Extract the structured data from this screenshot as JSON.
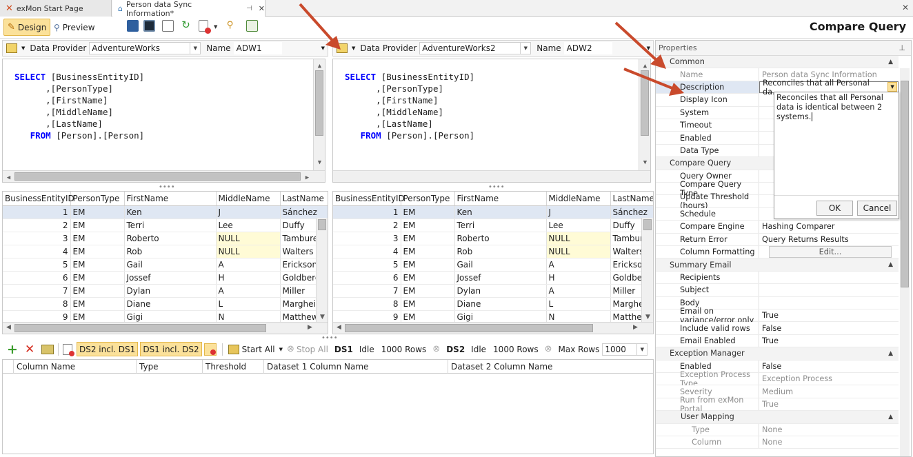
{
  "tabs": [
    {
      "label": "exMon Start Page",
      "active": false
    },
    {
      "label": "Person data Sync Information*",
      "active": true
    }
  ],
  "toolbar": {
    "design_label": "Design",
    "preview_label": "Preview",
    "page_title": "Compare Query"
  },
  "ds1": {
    "provider_label": "Data Provider",
    "provider_value": "AdventureWorks",
    "name_label": "Name",
    "name_value": "ADW1",
    "sql": [
      "SELECT",
      "[BusinessEntityID]",
      ",[PersonType]",
      ",[FirstName]",
      ",[MiddleName]",
      ",[LastName]",
      "FROM",
      "[Person].[Person]"
    ]
  },
  "ds2": {
    "provider_label": "Data Provider",
    "provider_value": "AdventureWorks2",
    "name_label": "Name",
    "name_value": "ADW2",
    "sql": [
      "SELECT",
      "[BusinessEntityID]",
      ",[PersonType]",
      ",[FirstName]",
      ",[MiddleName]",
      ",[LastName]",
      "FROM",
      "[Person].[Person]"
    ]
  },
  "grid": {
    "columns": [
      "BusinessEntityID",
      "PersonType",
      "FirstName",
      "MiddleName",
      "LastName"
    ],
    "rows1": [
      [
        "1",
        "EM",
        "Ken",
        "J",
        "Sánchez"
      ],
      [
        "2",
        "EM",
        "Terri",
        "Lee",
        "Duffy"
      ],
      [
        "3",
        "EM",
        "Roberto",
        "NULL",
        "Tamburello"
      ],
      [
        "4",
        "EM",
        "Rob",
        "NULL",
        "Walters"
      ],
      [
        "5",
        "EM",
        "Gail",
        "A",
        "Erickson"
      ],
      [
        "6",
        "EM",
        "Jossef",
        "H",
        "Goldberg"
      ],
      [
        "7",
        "EM",
        "Dylan",
        "A",
        "Miller"
      ],
      [
        "8",
        "EM",
        "Diane",
        "L",
        "Margheim"
      ],
      [
        "9",
        "EM",
        "Gigi",
        "N",
        "Matthew"
      ]
    ],
    "rows2": [
      [
        "1",
        "EM",
        "Ken",
        "J",
        "Sánchez"
      ],
      [
        "2",
        "EM",
        "Terri",
        "Lee",
        "Duffy"
      ],
      [
        "3",
        "EM",
        "Roberto",
        "NULL",
        "Tambure"
      ],
      [
        "4",
        "EM",
        "Rob",
        "NULL",
        "Walters"
      ],
      [
        "5",
        "EM",
        "Gail",
        "A",
        "Erickson"
      ],
      [
        "6",
        "EM",
        "Jossef",
        "H",
        "Goldberg"
      ],
      [
        "7",
        "EM",
        "Dylan",
        "A",
        "Miller"
      ],
      [
        "8",
        "EM",
        "Diane",
        "L",
        "Margheim"
      ],
      [
        "9",
        "EM",
        "Gigi",
        "N",
        "Matthew"
      ]
    ]
  },
  "compare_toolbar": {
    "ds2_incl_ds1": "DS2 incl. DS1",
    "ds1_incl_ds2": "DS1 incl. DS2",
    "start_all": "Start All",
    "stop_all": "Stop All",
    "ds1_label": "DS1",
    "ds1_status": "Idle",
    "ds1_rows": "1000 Rows",
    "ds2_label": "DS2",
    "ds2_status": "Idle",
    "ds2_rows": "1000 Rows",
    "max_rows_label": "Max Rows",
    "max_rows_value": "1000"
  },
  "compare_grid": {
    "columns": [
      "Column Name",
      "Type",
      "Threshold",
      "Dataset 1 Column Name",
      "Dataset 2 Column Name"
    ]
  },
  "properties": {
    "title": "Properties",
    "rows": [
      {
        "kind": "cat",
        "label": "Common"
      },
      {
        "kind": "prop",
        "label": "Name",
        "value": "Person data Sync Information",
        "dim": true
      },
      {
        "kind": "prop",
        "label": "Description",
        "value": "Reconciles that all Personal da...",
        "selected": true
      },
      {
        "kind": "prop",
        "label": "Display Icon",
        "value": ""
      },
      {
        "kind": "prop",
        "label": "System",
        "value": ""
      },
      {
        "kind": "prop",
        "label": "Timeout",
        "value": ""
      },
      {
        "kind": "prop",
        "label": "Enabled",
        "value": ""
      },
      {
        "kind": "prop",
        "label": "Data Type",
        "value": ""
      },
      {
        "kind": "cat",
        "label": "Compare Query"
      },
      {
        "kind": "prop",
        "label": "Query Owner",
        "value": ""
      },
      {
        "kind": "prop",
        "label": "Compare Query Type",
        "value": ""
      },
      {
        "kind": "prop",
        "label": "Update Threshold (hours)",
        "value": ""
      },
      {
        "kind": "prop",
        "label": "Schedule",
        "value": ""
      },
      {
        "kind": "prop",
        "label": "Compare Engine",
        "value": "Hashing Comparer"
      },
      {
        "kind": "prop",
        "label": "Return Error",
        "value": "Query Returns Results"
      },
      {
        "kind": "prop",
        "label": "Column Formatting",
        "value": "Edit...",
        "button": true
      },
      {
        "kind": "cat",
        "label": "Summary Email"
      },
      {
        "kind": "prop",
        "label": "Recipients",
        "value": ""
      },
      {
        "kind": "prop",
        "label": "Subject",
        "value": ""
      },
      {
        "kind": "prop",
        "label": "Body",
        "value": ""
      },
      {
        "kind": "prop",
        "label": "Email on variance/error only",
        "value": "True"
      },
      {
        "kind": "prop",
        "label": "Include valid rows",
        "value": "False"
      },
      {
        "kind": "prop",
        "label": "Email Enabled",
        "value": "True"
      },
      {
        "kind": "cat",
        "label": "Exception Manager"
      },
      {
        "kind": "prop",
        "label": "Enabled",
        "value": "False"
      },
      {
        "kind": "prop",
        "label": "Exception Process Type",
        "value": "Exception Process",
        "dim": true
      },
      {
        "kind": "prop",
        "label": "Severity",
        "value": "Medium",
        "dim": true
      },
      {
        "kind": "prop",
        "label": "Run from exMon Portal",
        "value": "True",
        "dim": true
      },
      {
        "kind": "sub",
        "label": "User Mapping"
      },
      {
        "kind": "prop2",
        "label": "Type",
        "value": "None",
        "dim": true
      },
      {
        "kind": "prop2",
        "label": "Column",
        "value": "None",
        "dim": true
      }
    ],
    "popup": {
      "text": "Reconciles that all Personal data is identical between 2 systems.",
      "ok": "OK",
      "cancel": "Cancel"
    }
  },
  "colors": {
    "accent_yellow": "#fbe19a",
    "arrow_red": "#c94a2c",
    "sql_keyword": "#0000ff",
    "null_cell": "#fffbd6"
  }
}
